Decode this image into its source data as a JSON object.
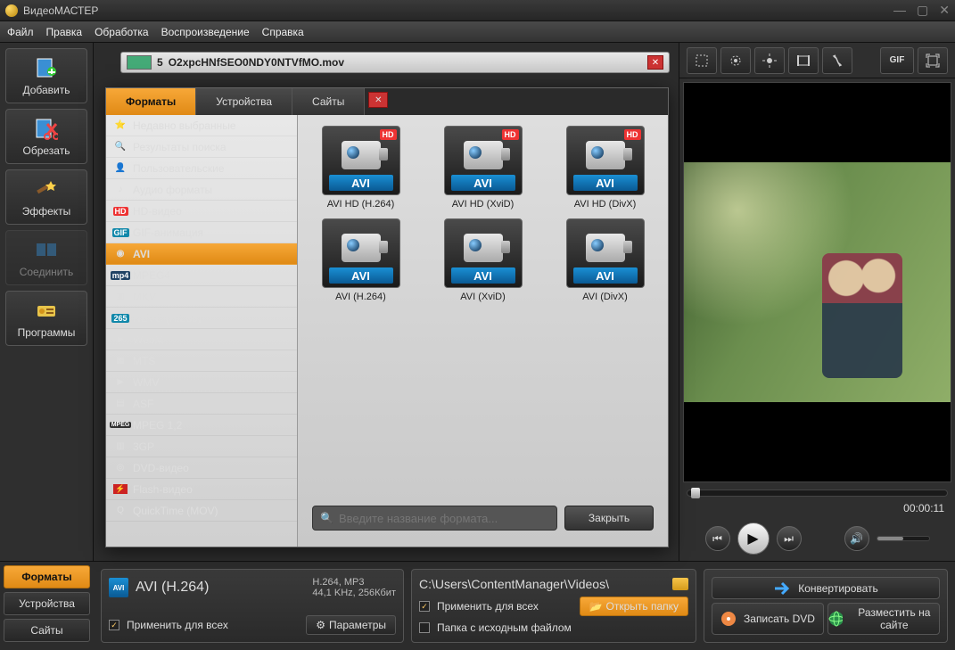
{
  "app_title": "ВидеоМАСТЕР",
  "menubar": [
    "Файл",
    "Правка",
    "Обработка",
    "Воспроизведение",
    "Справка"
  ],
  "left_buttons": [
    {
      "label": "Добавить",
      "icon": "add"
    },
    {
      "label": "Обрезать",
      "icon": "cut"
    },
    {
      "label": "Эффекты",
      "icon": "fx"
    },
    {
      "label": "Соединить",
      "icon": "join",
      "disabled": true
    },
    {
      "label": "Программы",
      "icon": "prog"
    }
  ],
  "file_row": {
    "index": "5",
    "name": "O2xpcHNfSEO0NDY0NTVfMO.mov"
  },
  "preview_tools": [
    "crop",
    "rotate",
    "brightness",
    "frame",
    "speed"
  ],
  "preview_tools_right": [
    "gif",
    "fullscreen"
  ],
  "time": "00:00:11",
  "bottom_tabs": [
    "Форматы",
    "Устройства",
    "Сайты"
  ],
  "bottom_active_tab": 0,
  "format_panel": {
    "name": "AVI (H.264)",
    "codec_line1": "H.264, MP3",
    "codec_line2": "44,1 KHz, 256Кбит",
    "apply_all": "Применить для всех",
    "params": "Параметры"
  },
  "output_panel": {
    "path": "C:\\Users\\ContentManager\\Videos\\",
    "apply_all": "Применить для всех",
    "same_folder": "Папка с исходным файлом",
    "open_folder": "Открыть папку"
  },
  "action_panel": {
    "convert": "Конвертировать",
    "burn": "Записать DVD",
    "upload": "Разместить на сайте"
  },
  "modal": {
    "tabs": [
      "Форматы",
      "Устройства",
      "Сайты"
    ],
    "active_tab": 0,
    "side_items": [
      {
        "label": "Недавно выбранные",
        "icon": "recent"
      },
      {
        "label": "Результаты поиска",
        "icon": "search"
      },
      {
        "label": "Пользовательские",
        "icon": "user"
      },
      {
        "label": "Аудио форматы",
        "icon": "audio"
      },
      {
        "label": "HD-видео",
        "icon": "hd"
      },
      {
        "label": "GIF-анимация",
        "icon": "gif"
      },
      {
        "label": "AVI",
        "icon": "disc",
        "selected": true
      },
      {
        "label": "MPEG4",
        "icon": "mp4"
      },
      {
        "label": "MKV",
        "icon": "mkv"
      },
      {
        "label": "HEVC (H.265)",
        "icon": "hevc"
      },
      {
        "label": "WebM",
        "icon": "webm"
      },
      {
        "label": "MTS",
        "icon": "mts"
      },
      {
        "label": "WMV",
        "icon": "wmv"
      },
      {
        "label": "ASF",
        "icon": "asf"
      },
      {
        "label": "MPEG 1,2",
        "icon": "mpeg"
      },
      {
        "label": "3GP",
        "icon": "3gp"
      },
      {
        "label": "DVD-видео",
        "icon": "dvd"
      },
      {
        "label": "Flash-видео",
        "icon": "flash"
      },
      {
        "label": "QuickTime (MOV)",
        "icon": "qt"
      }
    ],
    "formats": [
      {
        "tag": "AVI",
        "caption": "AVI HD (H.264)",
        "hd": true
      },
      {
        "tag": "AVI",
        "caption": "AVI HD (XviD)",
        "hd": true
      },
      {
        "tag": "AVI",
        "caption": "AVI HD (DivX)",
        "hd": true
      },
      {
        "tag": "AVI",
        "caption": "AVI (H.264)",
        "hd": false
      },
      {
        "tag": "AVI",
        "caption": "AVI (XviD)",
        "hd": false
      },
      {
        "tag": "AVI",
        "caption": "AVI (DivX)",
        "hd": false
      }
    ],
    "search_placeholder": "Введите название формата...",
    "close": "Закрыть"
  }
}
